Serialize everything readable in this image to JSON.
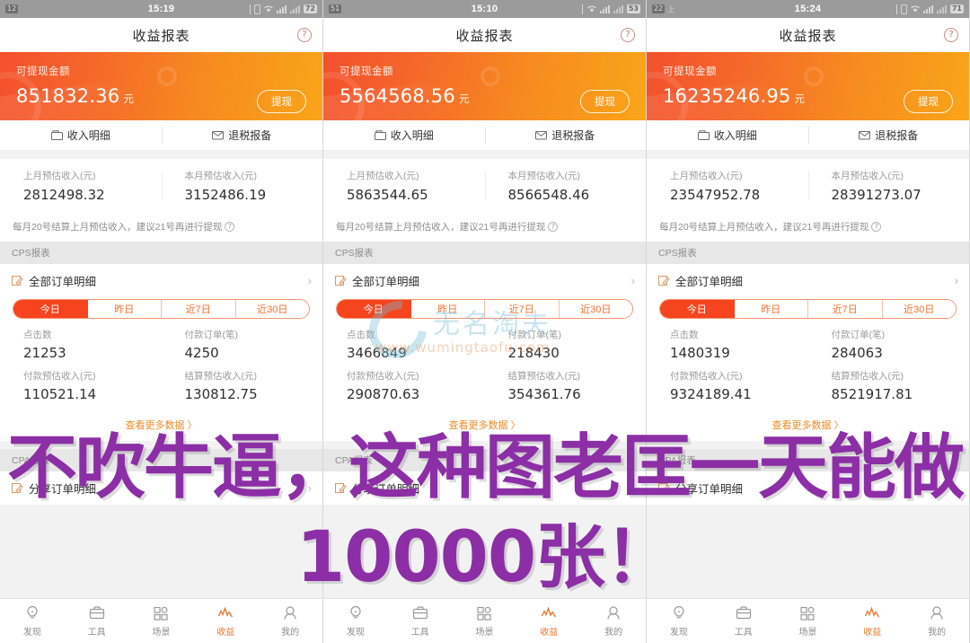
{
  "overlay": {
    "line1": "不吹牛逼，这种图老匡一天能做",
    "line2": "10000张！",
    "color": "#8c2ea6"
  },
  "watermark": {
    "text": "无名淘夫",
    "url": "www.wumingtaofu.com"
  },
  "theme": {
    "banner_start": "#f4502c",
    "banner_end": "#f9a519",
    "accent": "#f5441e",
    "link": "#ef8b2b",
    "active_tab": "#e8742b"
  },
  "icons": {
    "help": "?",
    "income_detail": "wallet-icon",
    "tax_report": "mail-icon",
    "order_detail": "note-pen-icon",
    "chevron": "›",
    "note_help": "?"
  },
  "common": {
    "nav_title": "收益报表",
    "banner_label": "可提现金额",
    "banner_unit": "元",
    "withdraw_label": "提现",
    "links": [
      {
        "label": "收入明细",
        "icon": "wallet-icon"
      },
      {
        "label": "退税报备",
        "icon": "mail-icon"
      }
    ],
    "estimate_labels": {
      "last_month": "上月预估收入(元)",
      "this_month": "本月预估收入(元)"
    },
    "note": "每月20号结算上月预估收入，建议21号再进行提现",
    "cps_section": "CPS报表",
    "cpa_section": "CPA报表",
    "all_orders": "全部订单明细",
    "share_orders": "分享订单明细",
    "segments": [
      "今日",
      "昨日",
      "近7日",
      "近30日"
    ],
    "active_segment": "今日",
    "stat_labels": {
      "clicks": "点击数",
      "paid_orders": "付款订单(笔)",
      "paid_income": "付款预估收入(元)",
      "settle_income": "结算预估收入(元)"
    },
    "more_label": "查看更多数据 〉",
    "tabs": [
      {
        "label": "发现",
        "icon": "lightbulb-icon",
        "active": false
      },
      {
        "label": "工具",
        "icon": "briefcase-icon",
        "active": false
      },
      {
        "label": "场景",
        "icon": "grid-icon",
        "active": false
      },
      {
        "label": "收益",
        "icon": "chart-icon",
        "active": true
      },
      {
        "label": "我的",
        "icon": "person-icon",
        "active": false
      }
    ]
  },
  "panels": [
    {
      "status": {
        "badge": "12",
        "sup": "",
        "time": "15:19",
        "battery": "72"
      },
      "balance": "851832.36",
      "last_month": "2812498.32",
      "this_month": "3152486.19",
      "clicks": "21253",
      "paid_orders": "4250",
      "paid_income": "110521.14",
      "settle_income": "130812.75"
    },
    {
      "status": {
        "badge": "51",
        "sup": "",
        "time": "15:10",
        "battery": "53"
      },
      "balance": "5564568.56",
      "last_month": "5863544.65",
      "this_month": "8566548.46",
      "clicks": "3466849",
      "paid_orders": "218430",
      "paid_income": "290870.63",
      "settle_income": "354361.76"
    },
    {
      "status": {
        "badge": "22",
        "sup": "上",
        "time": "15:24",
        "battery": "71"
      },
      "balance": "16235246.95",
      "last_month": "23547952.78",
      "this_month": "28391273.07",
      "clicks": "1480319",
      "paid_orders": "284063",
      "paid_income": "9324189.41",
      "settle_income": "8521917.81"
    }
  ]
}
